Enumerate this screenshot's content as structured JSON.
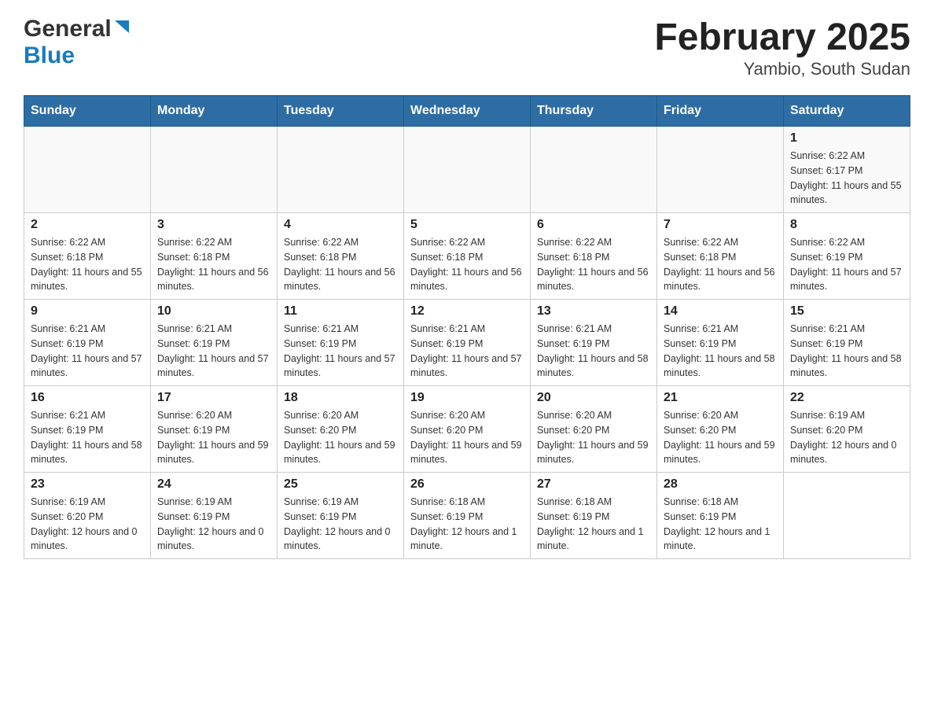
{
  "header": {
    "logo_general": "General",
    "logo_blue": "Blue",
    "month_title": "February 2025",
    "location": "Yambio, South Sudan"
  },
  "days_of_week": [
    "Sunday",
    "Monday",
    "Tuesday",
    "Wednesday",
    "Thursday",
    "Friday",
    "Saturday"
  ],
  "weeks": [
    [
      {
        "day": "",
        "info": ""
      },
      {
        "day": "",
        "info": ""
      },
      {
        "day": "",
        "info": ""
      },
      {
        "day": "",
        "info": ""
      },
      {
        "day": "",
        "info": ""
      },
      {
        "day": "",
        "info": ""
      },
      {
        "day": "1",
        "info": "Sunrise: 6:22 AM\nSunset: 6:17 PM\nDaylight: 11 hours and 55 minutes."
      }
    ],
    [
      {
        "day": "2",
        "info": "Sunrise: 6:22 AM\nSunset: 6:18 PM\nDaylight: 11 hours and 55 minutes."
      },
      {
        "day": "3",
        "info": "Sunrise: 6:22 AM\nSunset: 6:18 PM\nDaylight: 11 hours and 56 minutes."
      },
      {
        "day": "4",
        "info": "Sunrise: 6:22 AM\nSunset: 6:18 PM\nDaylight: 11 hours and 56 minutes."
      },
      {
        "day": "5",
        "info": "Sunrise: 6:22 AM\nSunset: 6:18 PM\nDaylight: 11 hours and 56 minutes."
      },
      {
        "day": "6",
        "info": "Sunrise: 6:22 AM\nSunset: 6:18 PM\nDaylight: 11 hours and 56 minutes."
      },
      {
        "day": "7",
        "info": "Sunrise: 6:22 AM\nSunset: 6:18 PM\nDaylight: 11 hours and 56 minutes."
      },
      {
        "day": "8",
        "info": "Sunrise: 6:22 AM\nSunset: 6:19 PM\nDaylight: 11 hours and 57 minutes."
      }
    ],
    [
      {
        "day": "9",
        "info": "Sunrise: 6:21 AM\nSunset: 6:19 PM\nDaylight: 11 hours and 57 minutes."
      },
      {
        "day": "10",
        "info": "Sunrise: 6:21 AM\nSunset: 6:19 PM\nDaylight: 11 hours and 57 minutes."
      },
      {
        "day": "11",
        "info": "Sunrise: 6:21 AM\nSunset: 6:19 PM\nDaylight: 11 hours and 57 minutes."
      },
      {
        "day": "12",
        "info": "Sunrise: 6:21 AM\nSunset: 6:19 PM\nDaylight: 11 hours and 57 minutes."
      },
      {
        "day": "13",
        "info": "Sunrise: 6:21 AM\nSunset: 6:19 PM\nDaylight: 11 hours and 58 minutes."
      },
      {
        "day": "14",
        "info": "Sunrise: 6:21 AM\nSunset: 6:19 PM\nDaylight: 11 hours and 58 minutes."
      },
      {
        "day": "15",
        "info": "Sunrise: 6:21 AM\nSunset: 6:19 PM\nDaylight: 11 hours and 58 minutes."
      }
    ],
    [
      {
        "day": "16",
        "info": "Sunrise: 6:21 AM\nSunset: 6:19 PM\nDaylight: 11 hours and 58 minutes."
      },
      {
        "day": "17",
        "info": "Sunrise: 6:20 AM\nSunset: 6:19 PM\nDaylight: 11 hours and 59 minutes."
      },
      {
        "day": "18",
        "info": "Sunrise: 6:20 AM\nSunset: 6:20 PM\nDaylight: 11 hours and 59 minutes."
      },
      {
        "day": "19",
        "info": "Sunrise: 6:20 AM\nSunset: 6:20 PM\nDaylight: 11 hours and 59 minutes."
      },
      {
        "day": "20",
        "info": "Sunrise: 6:20 AM\nSunset: 6:20 PM\nDaylight: 11 hours and 59 minutes."
      },
      {
        "day": "21",
        "info": "Sunrise: 6:20 AM\nSunset: 6:20 PM\nDaylight: 11 hours and 59 minutes."
      },
      {
        "day": "22",
        "info": "Sunrise: 6:19 AM\nSunset: 6:20 PM\nDaylight: 12 hours and 0 minutes."
      }
    ],
    [
      {
        "day": "23",
        "info": "Sunrise: 6:19 AM\nSunset: 6:20 PM\nDaylight: 12 hours and 0 minutes."
      },
      {
        "day": "24",
        "info": "Sunrise: 6:19 AM\nSunset: 6:19 PM\nDaylight: 12 hours and 0 minutes."
      },
      {
        "day": "25",
        "info": "Sunrise: 6:19 AM\nSunset: 6:19 PM\nDaylight: 12 hours and 0 minutes."
      },
      {
        "day": "26",
        "info": "Sunrise: 6:18 AM\nSunset: 6:19 PM\nDaylight: 12 hours and 1 minute."
      },
      {
        "day": "27",
        "info": "Sunrise: 6:18 AM\nSunset: 6:19 PM\nDaylight: 12 hours and 1 minute."
      },
      {
        "day": "28",
        "info": "Sunrise: 6:18 AM\nSunset: 6:19 PM\nDaylight: 12 hours and 1 minute."
      },
      {
        "day": "",
        "info": ""
      }
    ]
  ]
}
